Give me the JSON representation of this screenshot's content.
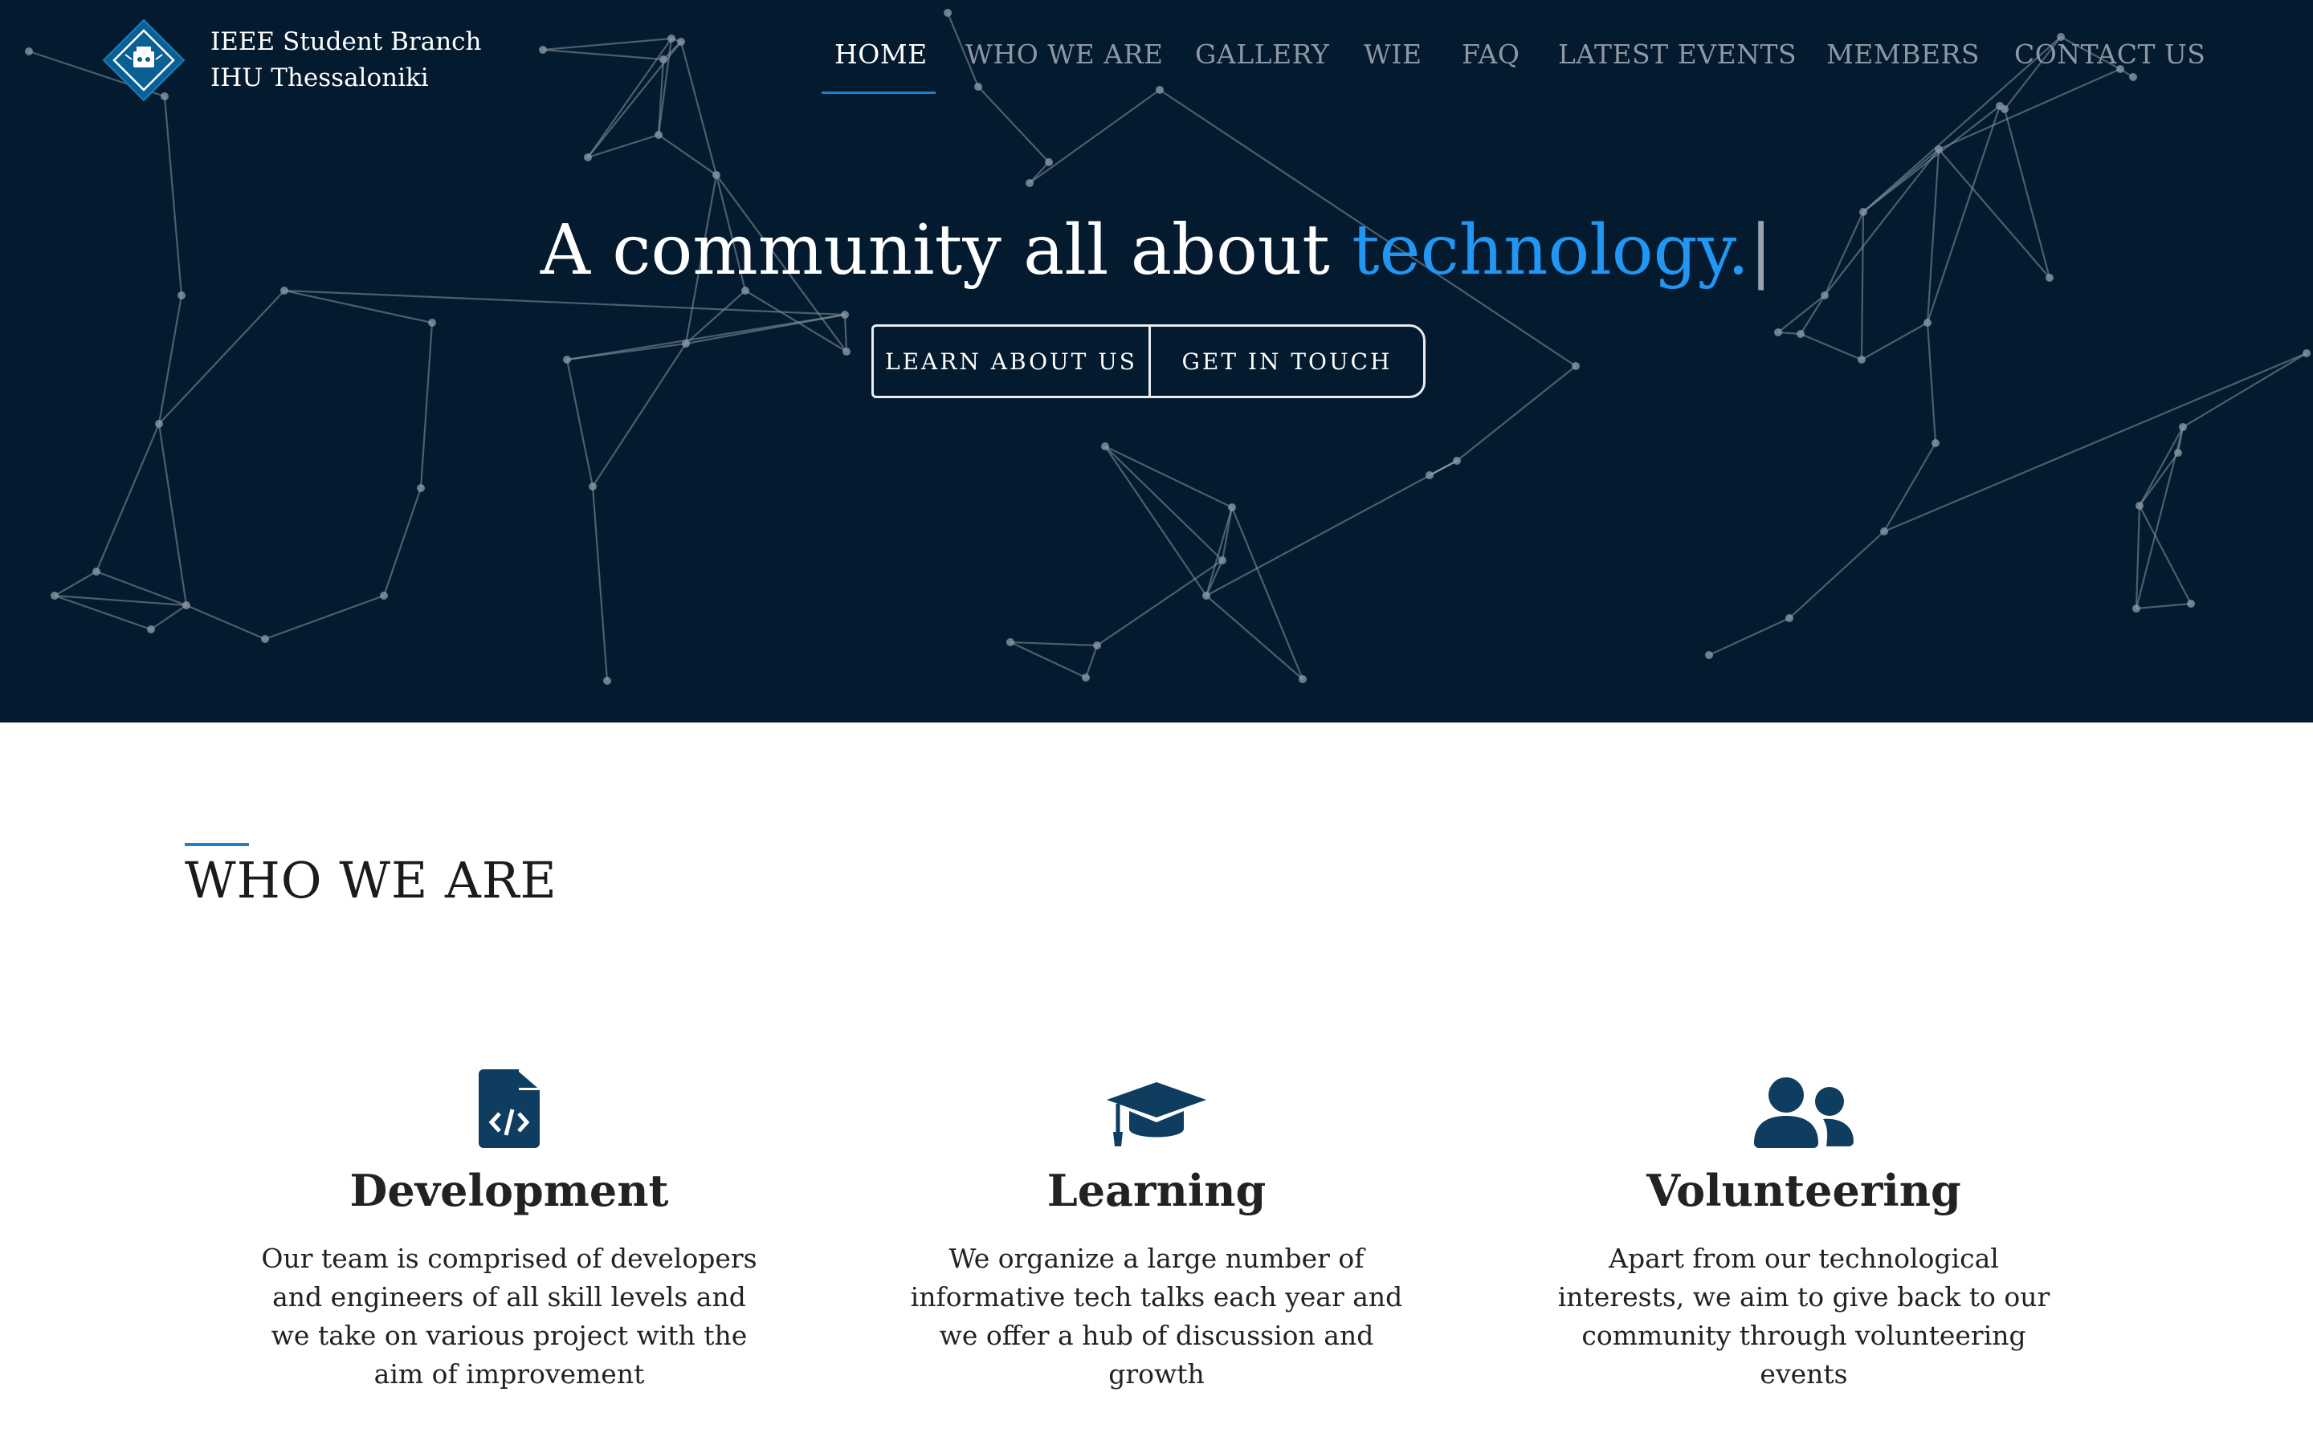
{
  "brand": {
    "line1": "IEEE Student Branch",
    "line2": "IHU Thessaloniki",
    "logo_icon": "ieee-diamond-logo-icon"
  },
  "nav": {
    "items": [
      {
        "label": "HOME",
        "active": true
      },
      {
        "label": "WHO WE ARE",
        "active": false
      },
      {
        "label": "GALLERY",
        "active": false
      },
      {
        "label": "WIE",
        "active": false
      },
      {
        "label": "FAQ",
        "active": false
      },
      {
        "label": "LATEST EVENTS",
        "active": false
      },
      {
        "label": "MEMBERS",
        "active": false
      },
      {
        "label": "CONTACT US",
        "active": false
      }
    ]
  },
  "hero": {
    "headline_prefix": "A community all about ",
    "headline_accent": "technology.",
    "cursor": "|",
    "btn_learn": "LEARN ABOUT US",
    "btn_contact": "GET IN TOUCH"
  },
  "section": {
    "title": "WHO WE ARE"
  },
  "features": [
    {
      "icon": "file-code-icon",
      "title": "Development",
      "desc": "Our team is comprised of developers and engineers of all skill levels and we take on various project with the aim of improvement"
    },
    {
      "icon": "graduation-cap-icon",
      "title": "Learning",
      "desc": "We organize a large number of informative tech talks each year and we offer a hub of discussion and growth"
    },
    {
      "icon": "users-icon",
      "title": "Volunteering",
      "desc": "Apart from our technological interests, we aim to give back to our community through volunteering events"
    }
  ],
  "colors": {
    "hero_bg": "#041a2e",
    "accent": "#2196f3",
    "icon": "#0f3d5f",
    "nav_active_underline": "#1e7fd0"
  }
}
